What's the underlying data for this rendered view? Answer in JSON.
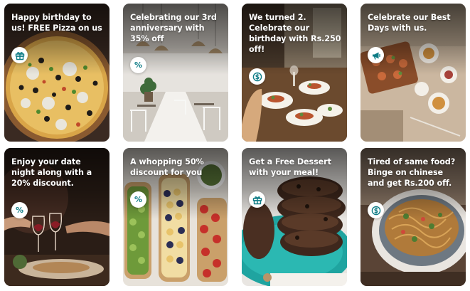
{
  "theme": {
    "accent": "#0e7c86"
  },
  "cards": [
    {
      "title": "Happy birthday to us! FREE Pizza on us",
      "icon": "gift-icon",
      "glyph": ""
    },
    {
      "title": "Celebrating our 3rd anniversary with 35% off",
      "icon": "percent-icon",
      "glyph": "%"
    },
    {
      "title": "We turned 2. Celebrate our birthday with Rs.250 off!",
      "icon": "dollar-coin-icon",
      "glyph": ""
    },
    {
      "title": "Celebrate our Best Days with us.",
      "icon": "megaphone-icon",
      "glyph": ""
    },
    {
      "title": "Enjoy your date night along with a 20% discount.",
      "icon": "percent-icon",
      "glyph": "%"
    },
    {
      "title": "A whopping 50% discount for you",
      "icon": "percent-icon",
      "glyph": "%"
    },
    {
      "title": "Get a Free Dessert with your meal!",
      "icon": "gift-icon",
      "glyph": ""
    },
    {
      "title": "Tired of same food? Binge on chinese and get Rs.200 off.",
      "icon": "dollar-coin-icon",
      "glyph": ""
    }
  ]
}
